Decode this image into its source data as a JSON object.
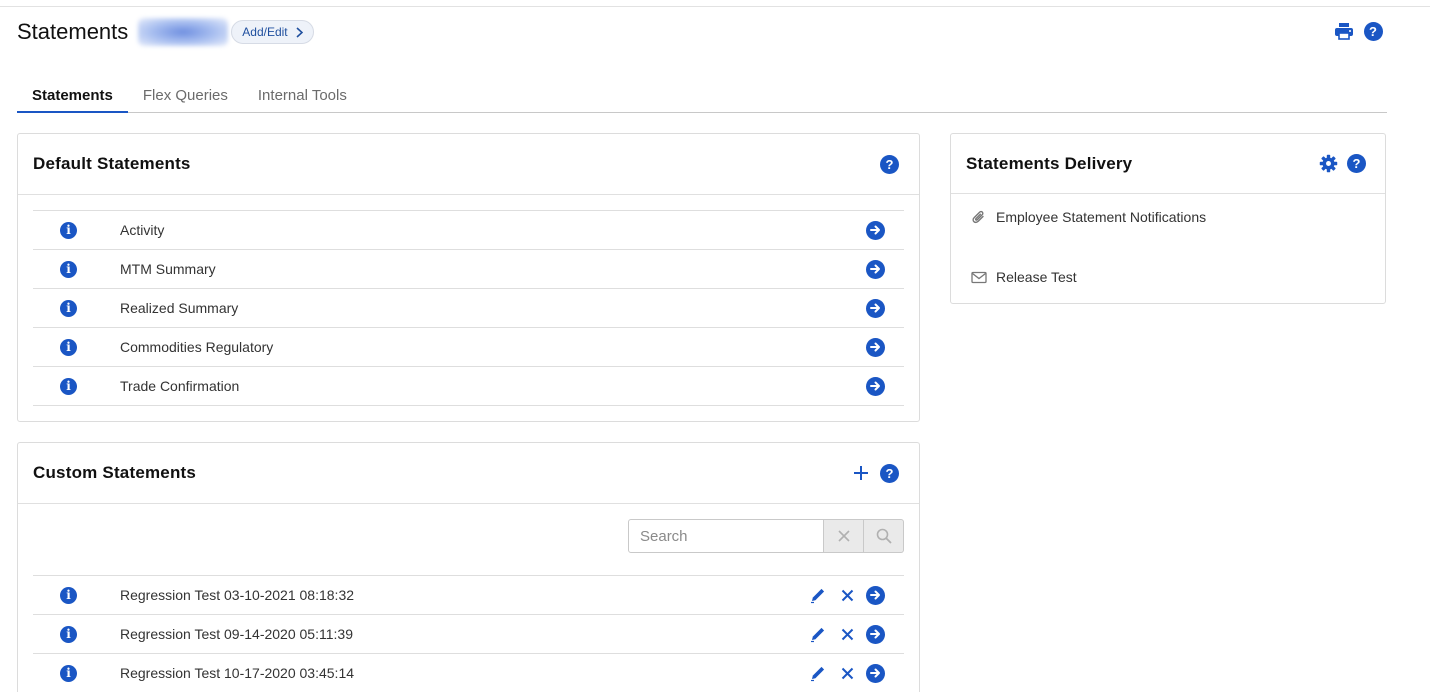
{
  "header": {
    "title": "Statements",
    "add_edit_label": "Add/Edit"
  },
  "tabs": [
    {
      "label": "Statements",
      "active": true
    },
    {
      "label": "Flex Queries",
      "active": false
    },
    {
      "label": "Internal Tools",
      "active": false
    }
  ],
  "default_statements": {
    "title": "Default Statements",
    "items": [
      {
        "label": "Activity"
      },
      {
        "label": "MTM Summary"
      },
      {
        "label": "Realized Summary"
      },
      {
        "label": "Commodities Regulatory"
      },
      {
        "label": "Trade Confirmation"
      }
    ]
  },
  "custom_statements": {
    "title": "Custom Statements",
    "search_placeholder": "Search",
    "items": [
      {
        "label": "Regression Test 03-10-2021 08:18:32"
      },
      {
        "label": "Regression Test 09-14-2020 05:11:39"
      },
      {
        "label": "Regression Test 10-17-2020 03:45:14"
      }
    ]
  },
  "statements_delivery": {
    "title": "Statements Delivery",
    "items": [
      {
        "label": "Employee Statement Notifications",
        "icon": "paperclip-icon"
      },
      {
        "label": "Release Test",
        "icon": "envelope-icon"
      }
    ]
  },
  "colors": {
    "accent": "#1a56c4",
    "border": "#dcdcdc",
    "text": "#333333"
  }
}
